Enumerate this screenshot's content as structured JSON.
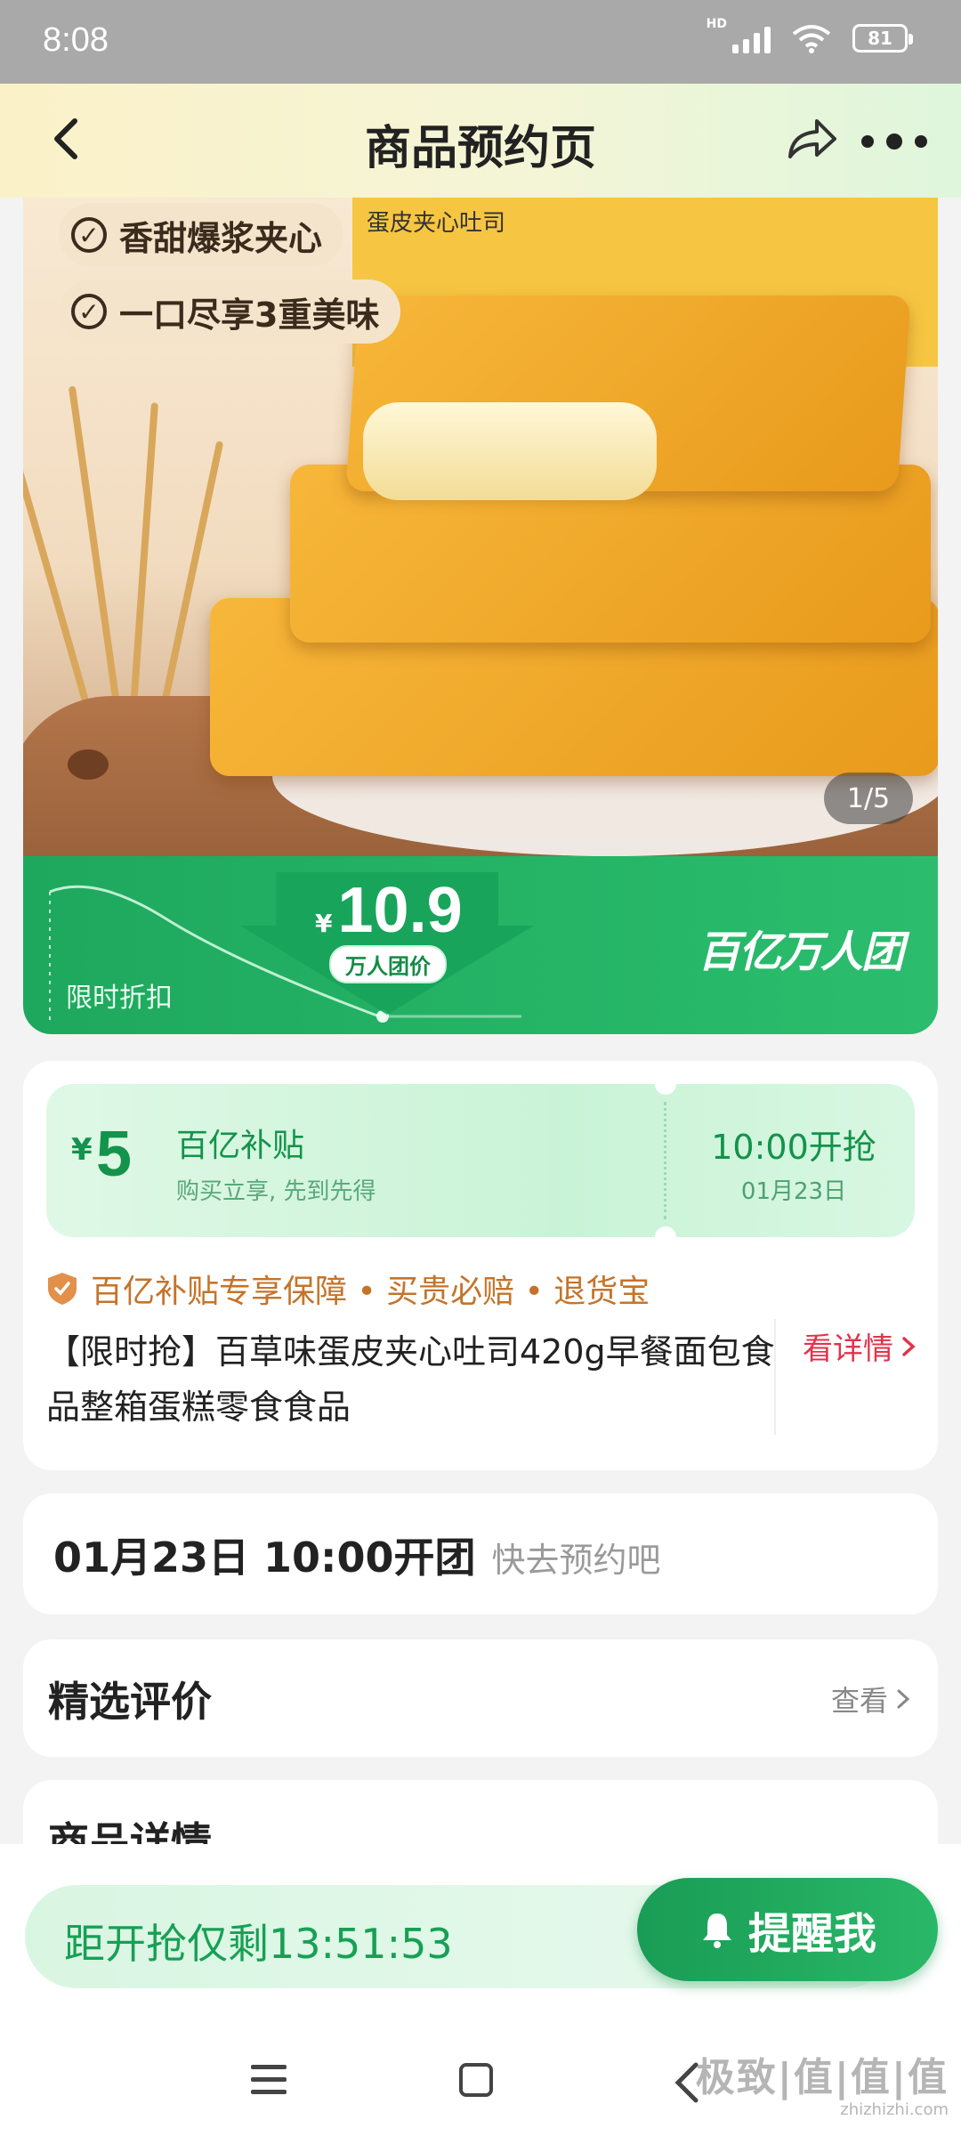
{
  "status_bar": {
    "time": "8:08",
    "network": "HD",
    "battery": "81"
  },
  "header": {
    "title": "商品预约页"
  },
  "hero": {
    "tags": [
      "香甜爆浆夹心",
      "一口尽享3重美味"
    ],
    "box_label": "蛋皮夹心吐司",
    "pager": "1/5"
  },
  "price_band": {
    "currency": "¥",
    "price": "10.9",
    "price_tag": "万人团价",
    "limited_label": "限时折扣",
    "brand": "百亿万人团"
  },
  "subsidy": {
    "currency": "¥",
    "amount": "5",
    "title": "百亿补贴",
    "subtitle": "购买立享, 先到先得",
    "start_time": "10:00开抢",
    "start_date": "01月23日"
  },
  "guarantee": "百亿补贴专享保障 • 买贵必赔 • 退货宝",
  "product_name": "【限时抢】百草味蛋皮夹心吐司420g早餐面包食品整箱蛋糕零食食品",
  "detail_link": "看详情",
  "group_open": {
    "time": "01月23日 10:00开团",
    "hint": "快去预约吧"
  },
  "reviews": {
    "title": "精选评价",
    "more": "查看"
  },
  "details_section": {
    "title": "商品详情"
  },
  "bottom_bar": {
    "countdown": "距开抢仅剩13:51:53",
    "remind_label": "提醒我"
  },
  "watermark": {
    "line1": "极致|值|值|值",
    "line2": "zhizhizhi.com"
  },
  "colors": {
    "accent_green": "#1ea85e",
    "price_red": "#e2334b",
    "guarantee_orange": "#c4742a"
  }
}
